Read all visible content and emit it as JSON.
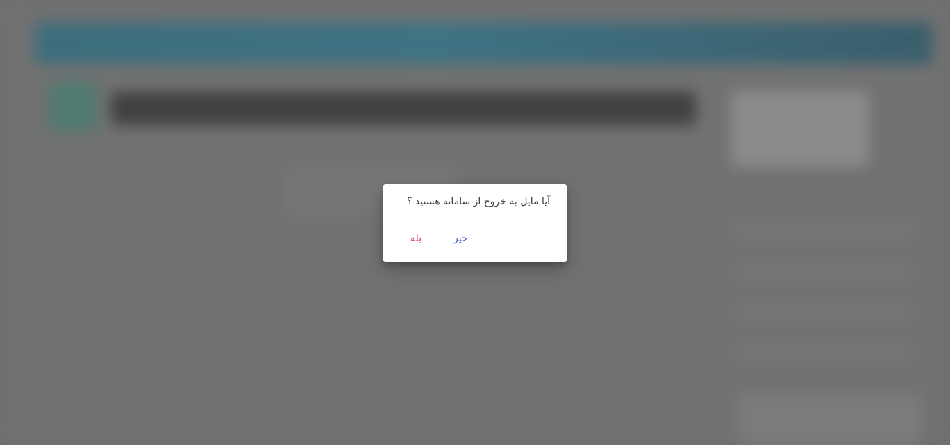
{
  "dialog": {
    "message": "آیا مایل به خروج از سامانه هستید ؟",
    "no_label": "خیر",
    "yes_label": "بله"
  },
  "colors": {
    "overlay": "#6f6f6f",
    "dialog_background": "#ffffff",
    "message_text": "#3d3d3d",
    "no_button": "#3f51b5",
    "yes_button": "#e91e63"
  }
}
